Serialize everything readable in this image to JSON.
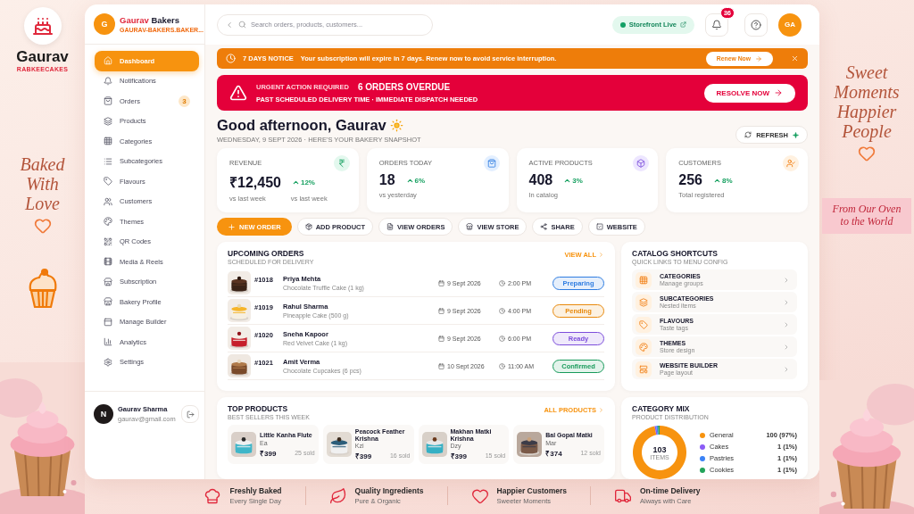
{
  "brand": {
    "logo_title": "Gaurav",
    "logo_subtitle": "RABKEECAKES",
    "tagline_left": "Baked With Love",
    "tagline_right": "Sweet Moments Happier People",
    "ribbon": "From Our Oven to the World"
  },
  "sidebar": {
    "avatar": "G",
    "name_first": "Gaurav",
    "name_second": "Bakers",
    "domain": "GAURAV-BAKERS.BAKER...",
    "items": [
      {
        "label": "Dashboard",
        "selected": true
      },
      {
        "label": "Notifications",
        "selected": false
      },
      {
        "label": "Orders",
        "selected": false,
        "badge": "3"
      },
      {
        "label": "Products",
        "selected": false
      },
      {
        "label": "Categories",
        "selected": false
      },
      {
        "label": "Subcategories",
        "selected": false
      },
      {
        "label": "Flavours",
        "selected": false
      },
      {
        "label": "Customers",
        "selected": false
      },
      {
        "label": "Themes",
        "selected": false
      },
      {
        "label": "QR Codes",
        "selected": false
      },
      {
        "label": "Media & Reels",
        "selected": false
      },
      {
        "label": "Subscription",
        "selected": false
      },
      {
        "label": "Bakery Profile",
        "selected": false
      },
      {
        "label": "Manage Builder",
        "selected": false
      },
      {
        "label": "Analytics",
        "selected": false
      },
      {
        "label": "Settings",
        "selected": false
      }
    ],
    "user": {
      "avatar": "N",
      "name": "Gaurav Sharma",
      "email": "gaurav@gmail.com"
    }
  },
  "topbar": {
    "search_placeholder": "Search orders, products, customers...",
    "storefront": "Storefront Live",
    "notification_count": "36",
    "avatar": "GA"
  },
  "notice": {
    "title": "7 DAYS NOTICE",
    "message": "Your subscription will expire in 7 days. Renew now to avoid service interruption.",
    "button": "Renew Now"
  },
  "alert": {
    "label": "URGENT ACTION REQUIRED",
    "title": "6 ORDERS OVERDUE",
    "message": "PAST SCHEDULED DELIVERY TIME · IMMEDIATE DISPATCH NEEDED",
    "button": "RESOLVE NOW"
  },
  "greeting": {
    "title": "Good afternoon, Gaurav",
    "subtitle": "WEDNESDAY, 9 SEPT 2026 · HERE'S YOUR BAKERY SNAPSHOT",
    "refresh": "REFRESH"
  },
  "stats": [
    {
      "label": "REVENUE",
      "value": "₹12,450",
      "change": "12%",
      "note": "vs last week",
      "change_note": "vs last week"
    },
    {
      "label": "ORDERS TODAY",
      "value": "18",
      "change": "6%",
      "note": "vs yesterday"
    },
    {
      "label": "ACTIVE PRODUCTS",
      "value": "408",
      "change": "3%",
      "note": "In catalog"
    },
    {
      "label": "CUSTOMERS",
      "value": "256",
      "change": "8%",
      "note": "Total registered"
    }
  ],
  "actions": [
    {
      "label": "NEW ORDER",
      "primary": true
    },
    {
      "label": "ADD PRODUCT",
      "primary": false
    },
    {
      "label": "VIEW ORDERS",
      "primary": false
    },
    {
      "label": "VIEW STORE",
      "primary": false
    },
    {
      "label": "SHARE",
      "primary": false
    },
    {
      "label": "WEBSITE",
      "primary": false
    }
  ],
  "orders": {
    "title": "UPCOMING ORDERS",
    "subtitle": "SCHEDULED FOR DELIVERY",
    "link": "VIEW ALL",
    "rows": [
      {
        "id": "#1018",
        "customer": "Priya Mehta",
        "item": "Chocolate Truffle Cake (1 kg)",
        "date": "9 Sept 2026",
        "time": "2:00 PM",
        "status": "Preparing",
        "color": "#2f7de1"
      },
      {
        "id": "#1019",
        "customer": "Rahul Sharma",
        "item": "Pineapple Cake (500 g)",
        "date": "9 Sept 2026",
        "time": "4:00 PM",
        "status": "Pending",
        "color": "#e8890c"
      },
      {
        "id": "#1020",
        "customer": "Sneha Kapoor",
        "item": "Red Velvet Cake (1 kg)",
        "date": "9 Sept 2026",
        "time": "6:00 PM",
        "status": "Ready",
        "color": "#7c4ddb"
      },
      {
        "id": "#1021",
        "customer": "Amit Verma",
        "item": "Chocolate Cupcakes (6 pcs)",
        "date": "10 Sept 2026",
        "time": "11:00 AM",
        "status": "Confirmed",
        "color": "#179a5a"
      }
    ]
  },
  "shortcuts": {
    "title": "CATALOG SHORTCUTS",
    "subtitle": "QUICK LINKS TO MENU CONFIG",
    "items": [
      {
        "title": "CATEGORIES",
        "subtitle": "Manage groups"
      },
      {
        "title": "SUBCATEGORIES",
        "subtitle": "Nested items"
      },
      {
        "title": "FLAVOURS",
        "subtitle": "Taste tags"
      },
      {
        "title": "THEMES",
        "subtitle": "Store design"
      },
      {
        "title": "WEBSITE BUILDER",
        "subtitle": "Page layout"
      }
    ]
  },
  "top_products": {
    "title": "TOP PRODUCTS",
    "subtitle": "BEST SELLERS THIS WEEK",
    "link": "ALL PRODUCTS",
    "items": [
      {
        "name": "Little Kanha Flute",
        "sub": "Ea",
        "price": "₹399",
        "sold": "25 sold"
      },
      {
        "name": "Peacock Feather Krishna",
        "sub": "Kzi",
        "price": "₹399",
        "sold": "16 sold"
      },
      {
        "name": "Makhan Matki Krishna",
        "sub": "Dzy",
        "price": "₹399",
        "sold": "15 sold"
      },
      {
        "name": "Bal Gopal Matki",
        "sub": "Mar",
        "price": "₹374",
        "sold": "12 sold"
      }
    ]
  },
  "category_mix": {
    "title": "CATEGORY MIX",
    "subtitle": "PRODUCT DISTRIBUTION",
    "total": "103",
    "total_label": "ITEMS",
    "legend": [
      {
        "value": "100 (97%)",
        "color": "#f7930f"
      },
      {
        "value": "1 (1%)",
        "color": "#8b5cf6"
      },
      {
        "value": "1 (1%)",
        "color": "#3b82f6"
      },
      {
        "value": "1 (1%)",
        "color": "#22a35a"
      }
    ],
    "chart_data": {
      "type": "donut",
      "categories": [
        "General",
        "Cakes",
        "Pastries",
        "Cookies"
      ],
      "values": [
        97,
        1,
        1,
        1
      ]
    }
  },
  "features": [
    {
      "title": "Freshly Baked",
      "subtitle": "Every Single Day"
    },
    {
      "title": "Quality Ingredients",
      "subtitle": "Pure & Organic"
    },
    {
      "title": "Happier Customers",
      "subtitle": "Sweeter Moments"
    },
    {
      "title": "On-time Delivery",
      "subtitle": "Always with Care"
    }
  ]
}
